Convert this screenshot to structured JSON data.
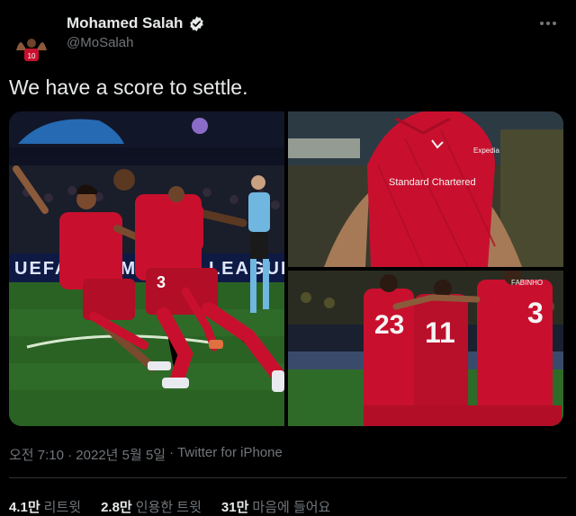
{
  "tweet": {
    "author_name": "Mohamed Salah",
    "author_handle": "@MoSalah",
    "text": "We have a score to settle.",
    "timestamp": "오전 7:10 · 2022년 5월 5일",
    "separator": "·",
    "client": "Twitter for iPhone"
  },
  "stats": [
    {
      "count": "4.1만",
      "label": "리트윗"
    },
    {
      "count": "2.8만",
      "label": "인용한 트윗"
    },
    {
      "count": "31만",
      "label": "마음에 들어요"
    }
  ],
  "images": {
    "left": {
      "board_text": "UEFA CHAMPIONS LEAGUE",
      "player_number": "3"
    },
    "top_right": {
      "sponsor": "Standard Chartered",
      "shirt_brand": "Expedia"
    },
    "bottom_right": {
      "numbers": [
        "23",
        "11",
        "3"
      ],
      "name_label": "FABINHO"
    }
  },
  "colors": {
    "background": "#000000",
    "text_primary": "#e7e9ea",
    "text_secondary": "#71767b",
    "verified": "#e7e9ea",
    "liverpool_red": "#c8102e",
    "pitch_green": "#2f6b28"
  },
  "icons": {
    "verified": "verified-badge-icon",
    "more": "more-options-icon"
  }
}
